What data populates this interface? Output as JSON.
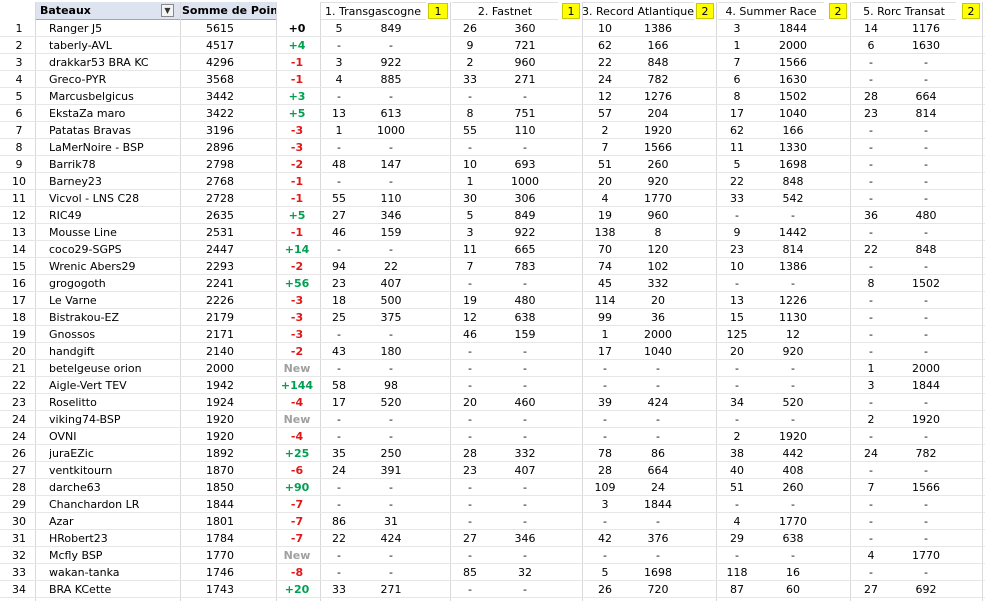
{
  "headers": {
    "bateaux": "Bateaux",
    "somme": "Somme de Points",
    "races": [
      {
        "title": "1. Transgascogne",
        "coef": "1"
      },
      {
        "title": "2. Fastnet",
        "coef": "1"
      },
      {
        "title": "3. Record Atlantique",
        "coef": "2"
      },
      {
        "title": "4. Summer Race",
        "coef": "2"
      },
      {
        "title": "5. Rorc Transat",
        "coef": "2"
      }
    ]
  },
  "colors": {
    "header_blue": "#dde4ef",
    "coef_yellow": "#ffff00",
    "positive": "#00a050",
    "negative": "#e01818",
    "new": "#a0a0a0"
  },
  "rows": [
    {
      "rank": "1",
      "name": "Ranger J5",
      "points": "5615",
      "change": "+0",
      "r": [
        [
          "5",
          "849"
        ],
        [
          "26",
          "360"
        ],
        [
          "10",
          "1386"
        ],
        [
          "3",
          "1844"
        ],
        [
          "14",
          "1176"
        ]
      ]
    },
    {
      "rank": "2",
      "name": "taberly-AVL",
      "points": "4517",
      "change": "+4",
      "r": [
        [
          "-",
          "-"
        ],
        [
          "9",
          "721"
        ],
        [
          "62",
          "166"
        ],
        [
          "1",
          "2000"
        ],
        [
          "6",
          "1630"
        ]
      ]
    },
    {
      "rank": "3",
      "name": "drakkar53 BRA KC",
      "points": "4296",
      "change": "-1",
      "r": [
        [
          "3",
          "922"
        ],
        [
          "2",
          "960"
        ],
        [
          "22",
          "848"
        ],
        [
          "7",
          "1566"
        ],
        [
          "-",
          "-"
        ]
      ]
    },
    {
      "rank": "4",
      "name": "Greco-PYR",
      "points": "3568",
      "change": "-1",
      "r": [
        [
          "4",
          "885"
        ],
        [
          "33",
          "271"
        ],
        [
          "24",
          "782"
        ],
        [
          "6",
          "1630"
        ],
        [
          "-",
          "-"
        ]
      ]
    },
    {
      "rank": "5",
      "name": "Marcusbelgicus",
      "points": "3442",
      "change": "+3",
      "r": [
        [
          "-",
          "-"
        ],
        [
          "-",
          "-"
        ],
        [
          "12",
          "1276"
        ],
        [
          "8",
          "1502"
        ],
        [
          "28",
          "664"
        ]
      ]
    },
    {
      "rank": "6",
      "name": "EkstaZa maro",
      "points": "3422",
      "change": "+5",
      "r": [
        [
          "13",
          "613"
        ],
        [
          "8",
          "751"
        ],
        [
          "57",
          "204"
        ],
        [
          "17",
          "1040"
        ],
        [
          "23",
          "814"
        ]
      ]
    },
    {
      "rank": "7",
      "name": "Patatas Bravas",
      "points": "3196",
      "change": "-3",
      "r": [
        [
          "1",
          "1000"
        ],
        [
          "55",
          "110"
        ],
        [
          "2",
          "1920"
        ],
        [
          "62",
          "166"
        ],
        [
          "-",
          "-"
        ]
      ]
    },
    {
      "rank": "8",
      "name": "LaMerNoire - BSP",
      "points": "2896",
      "change": "-3",
      "r": [
        [
          "-",
          "-"
        ],
        [
          "-",
          "-"
        ],
        [
          "7",
          "1566"
        ],
        [
          "11",
          "1330"
        ],
        [
          "-",
          "-"
        ]
      ]
    },
    {
      "rank": "9",
      "name": "Barrik78",
      "points": "2798",
      "change": "-2",
      "r": [
        [
          "48",
          "147"
        ],
        [
          "10",
          "693"
        ],
        [
          "51",
          "260"
        ],
        [
          "5",
          "1698"
        ],
        [
          "-",
          "-"
        ]
      ]
    },
    {
      "rank": "10",
      "name": "Barney23",
      "points": "2768",
      "change": "-1",
      "r": [
        [
          "-",
          "-"
        ],
        [
          "1",
          "1000"
        ],
        [
          "20",
          "920"
        ],
        [
          "22",
          "848"
        ],
        [
          "-",
          "-"
        ]
      ]
    },
    {
      "rank": "11",
      "name": "Vicvol - LNS C28",
      "points": "2728",
      "change": "-1",
      "r": [
        [
          "55",
          "110"
        ],
        [
          "30",
          "306"
        ],
        [
          "4",
          "1770"
        ],
        [
          "33",
          "542"
        ],
        [
          "-",
          "-"
        ]
      ]
    },
    {
      "rank": "12",
      "name": "RIC49",
      "points": "2635",
      "change": "+5",
      "r": [
        [
          "27",
          "346"
        ],
        [
          "5",
          "849"
        ],
        [
          "19",
          "960"
        ],
        [
          "-",
          "-"
        ],
        [
          "36",
          "480"
        ]
      ]
    },
    {
      "rank": "13",
      "name": "Mousse Line",
      "points": "2531",
      "change": "-1",
      "r": [
        [
          "46",
          "159"
        ],
        [
          "3",
          "922"
        ],
        [
          "138",
          "8"
        ],
        [
          "9",
          "1442"
        ],
        [
          "-",
          "-"
        ]
      ]
    },
    {
      "rank": "14",
      "name": "coco29-SGPS",
      "points": "2447",
      "change": "+14",
      "r": [
        [
          "-",
          "-"
        ],
        [
          "11",
          "665"
        ],
        [
          "70",
          "120"
        ],
        [
          "23",
          "814"
        ],
        [
          "22",
          "848"
        ]
      ]
    },
    {
      "rank": "15",
      "name": "Wrenic Abers29",
      "points": "2293",
      "change": "-2",
      "r": [
        [
          "94",
          "22"
        ],
        [
          "7",
          "783"
        ],
        [
          "74",
          "102"
        ],
        [
          "10",
          "1386"
        ],
        [
          "-",
          "-"
        ]
      ]
    },
    {
      "rank": "16",
      "name": "grogogoth",
      "points": "2241",
      "change": "+56",
      "r": [
        [
          "23",
          "407"
        ],
        [
          "-",
          "-"
        ],
        [
          "45",
          "332"
        ],
        [
          "-",
          "-"
        ],
        [
          "8",
          "1502"
        ]
      ]
    },
    {
      "rank": "17",
      "name": "Le Varne",
      "points": "2226",
      "change": "-3",
      "r": [
        [
          "18",
          "500"
        ],
        [
          "19",
          "480"
        ],
        [
          "114",
          "20"
        ],
        [
          "13",
          "1226"
        ],
        [
          "-",
          "-"
        ]
      ]
    },
    {
      "rank": "18",
      "name": "Bistrakou-EZ",
      "points": "2179",
      "change": "-3",
      "r": [
        [
          "25",
          "375"
        ],
        [
          "12",
          "638"
        ],
        [
          "99",
          "36"
        ],
        [
          "15",
          "1130"
        ],
        [
          "-",
          "-"
        ]
      ]
    },
    {
      "rank": "19",
      "name": "Gnossos",
      "points": "2171",
      "change": "-3",
      "r": [
        [
          "-",
          "-"
        ],
        [
          "46",
          "159"
        ],
        [
          "1",
          "2000"
        ],
        [
          "125",
          "12"
        ],
        [
          "-",
          "-"
        ]
      ]
    },
    {
      "rank": "20",
      "name": "handgift",
      "points": "2140",
      "change": "-2",
      "r": [
        [
          "43",
          "180"
        ],
        [
          "-",
          "-"
        ],
        [
          "17",
          "1040"
        ],
        [
          "20",
          "920"
        ],
        [
          "-",
          "-"
        ]
      ]
    },
    {
      "rank": "21",
      "name": "betelgeuse orion",
      "points": "2000",
      "change": "New",
      "r": [
        [
          "-",
          "-"
        ],
        [
          "-",
          "-"
        ],
        [
          "-",
          "-"
        ],
        [
          "-",
          "-"
        ],
        [
          "1",
          "2000"
        ]
      ]
    },
    {
      "rank": "22",
      "name": "Aigle-Vert TEV",
      "points": "1942",
      "change": "+144",
      "r": [
        [
          "58",
          "98"
        ],
        [
          "-",
          "-"
        ],
        [
          "-",
          "-"
        ],
        [
          "-",
          "-"
        ],
        [
          "3",
          "1844"
        ]
      ]
    },
    {
      "rank": "23",
      "name": "Roselitto",
      "points": "1924",
      "change": "-4",
      "r": [
        [
          "17",
          "520"
        ],
        [
          "20",
          "460"
        ],
        [
          "39",
          "424"
        ],
        [
          "34",
          "520"
        ],
        [
          "-",
          "-"
        ]
      ]
    },
    {
      "rank": "24",
      "name": "viking74-BSP",
      "points": "1920",
      "change": "New",
      "r": [
        [
          "-",
          "-"
        ],
        [
          "-",
          "-"
        ],
        [
          "-",
          "-"
        ],
        [
          "-",
          "-"
        ],
        [
          "2",
          "1920"
        ]
      ]
    },
    {
      "rank": "24",
      "name": "OVNI",
      "points": "1920",
      "change": "-4",
      "r": [
        [
          "-",
          "-"
        ],
        [
          "-",
          "-"
        ],
        [
          "-",
          "-"
        ],
        [
          "2",
          "1920"
        ],
        [
          "-",
          "-"
        ]
      ]
    },
    {
      "rank": "26",
      "name": "juraEZic",
      "points": "1892",
      "change": "+25",
      "r": [
        [
          "35",
          "250"
        ],
        [
          "28",
          "332"
        ],
        [
          "78",
          "86"
        ],
        [
          "38",
          "442"
        ],
        [
          "24",
          "782"
        ]
      ]
    },
    {
      "rank": "27",
      "name": "ventkitourn",
      "points": "1870",
      "change": "-6",
      "r": [
        [
          "24",
          "391"
        ],
        [
          "23",
          "407"
        ],
        [
          "28",
          "664"
        ],
        [
          "40",
          "408"
        ],
        [
          "-",
          "-"
        ]
      ]
    },
    {
      "rank": "28",
      "name": "darche63",
      "points": "1850",
      "change": "+90",
      "r": [
        [
          "-",
          "-"
        ],
        [
          "-",
          "-"
        ],
        [
          "109",
          "24"
        ],
        [
          "51",
          "260"
        ],
        [
          "7",
          "1566"
        ]
      ]
    },
    {
      "rank": "29",
      "name": "Chanchardon LR",
      "points": "1844",
      "change": "-7",
      "r": [
        [
          "-",
          "-"
        ],
        [
          "-",
          "-"
        ],
        [
          "3",
          "1844"
        ],
        [
          "-",
          "-"
        ],
        [
          "-",
          "-"
        ]
      ]
    },
    {
      "rank": "30",
      "name": "Azar",
      "points": "1801",
      "change": "-7",
      "r": [
        [
          "86",
          "31"
        ],
        [
          "-",
          "-"
        ],
        [
          "-",
          "-"
        ],
        [
          "4",
          "1770"
        ],
        [
          "-",
          "-"
        ]
      ]
    },
    {
      "rank": "31",
      "name": "HRobert23",
      "points": "1784",
      "change": "-7",
      "r": [
        [
          "22",
          "424"
        ],
        [
          "27",
          "346"
        ],
        [
          "42",
          "376"
        ],
        [
          "29",
          "638"
        ],
        [
          "-",
          "-"
        ]
      ]
    },
    {
      "rank": "32",
      "name": "Mcfly BSP",
      "points": "1770",
      "change": "New",
      "r": [
        [
          "-",
          "-"
        ],
        [
          "-",
          "-"
        ],
        [
          "-",
          "-"
        ],
        [
          "-",
          "-"
        ],
        [
          "4",
          "1770"
        ]
      ]
    },
    {
      "rank": "33",
      "name": "wakan-tanka",
      "points": "1746",
      "change": "-8",
      "r": [
        [
          "-",
          "-"
        ],
        [
          "85",
          "32"
        ],
        [
          "5",
          "1698"
        ],
        [
          "118",
          "16"
        ],
        [
          "-",
          "-"
        ]
      ]
    },
    {
      "rank": "34",
      "name": "BRA KCette",
      "points": "1743",
      "change": "+20",
      "r": [
        [
          "33",
          "271"
        ],
        [
          "-",
          "-"
        ],
        [
          "26",
          "720"
        ],
        [
          "87",
          "60"
        ],
        [
          "27",
          "692"
        ]
      ]
    }
  ]
}
